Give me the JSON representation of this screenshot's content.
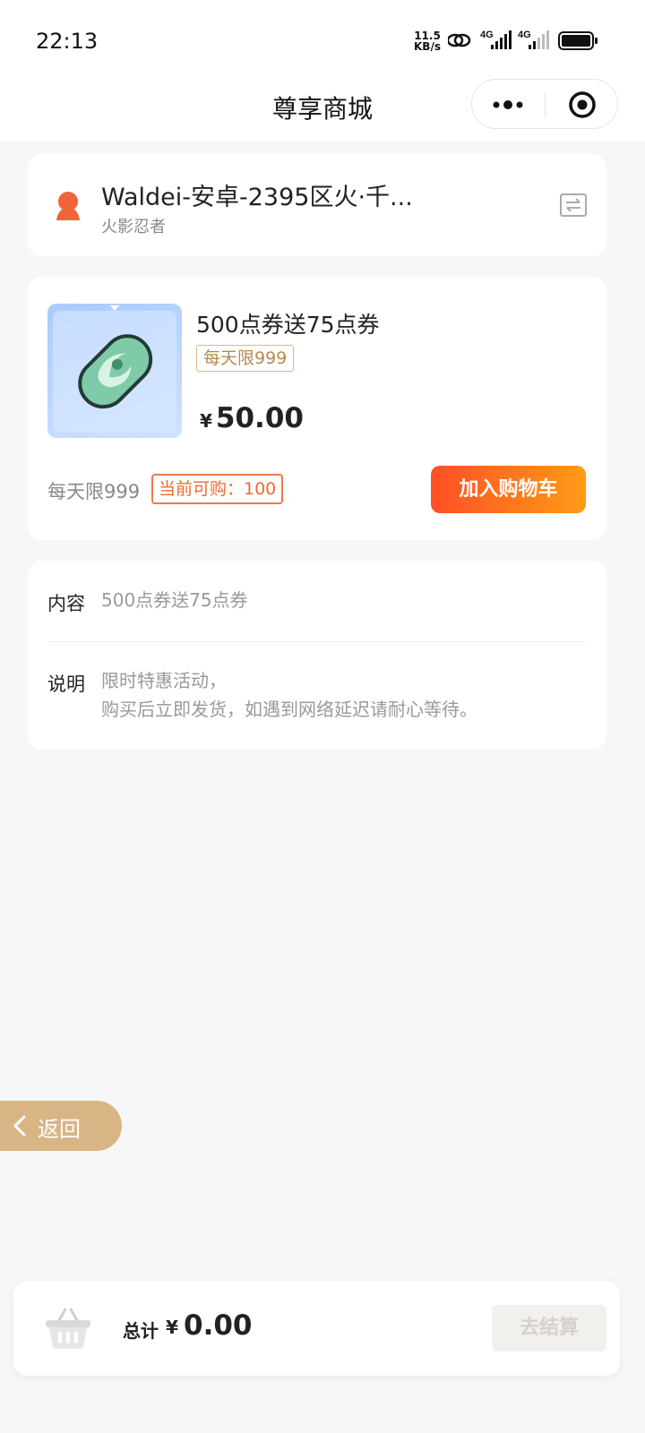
{
  "status_bar": {
    "time": "22:13",
    "net_speed_value": "11.5",
    "net_speed_unit": "KB/s",
    "signal1_label": "4G",
    "signal2_label": "4G"
  },
  "header": {
    "title": "尊享商城",
    "icons": [
      "more-icon",
      "target-icon"
    ]
  },
  "server": {
    "name": "Waldei-安卓-2395区火·千...",
    "game": "火影忍者",
    "icons": [
      "person-icon",
      "switch-icon"
    ]
  },
  "product": {
    "name": "500点券送75点券",
    "limit_badge": "每天限999",
    "currency": "¥",
    "price": "50.00",
    "limit_text": "每天限999",
    "purchasable": "当前可购：100",
    "add_to_cart": "加入购物车"
  },
  "details": {
    "content_label": "内容",
    "content_value": "500点券送75点券",
    "note_label": "说明",
    "note_line1": "限时特惠活动，",
    "note_line2": "购买后立即发货，如遇到网络延迟请耐心等待。"
  },
  "back": {
    "label": "返回"
  },
  "cart": {
    "total_label": "总计",
    "currency": "¥",
    "total": "0.00",
    "checkout": "去结算"
  },
  "colors": {
    "accent_orange": "#ff6a2a",
    "gold": "#d9b586",
    "background": "#f6f7f9"
  }
}
